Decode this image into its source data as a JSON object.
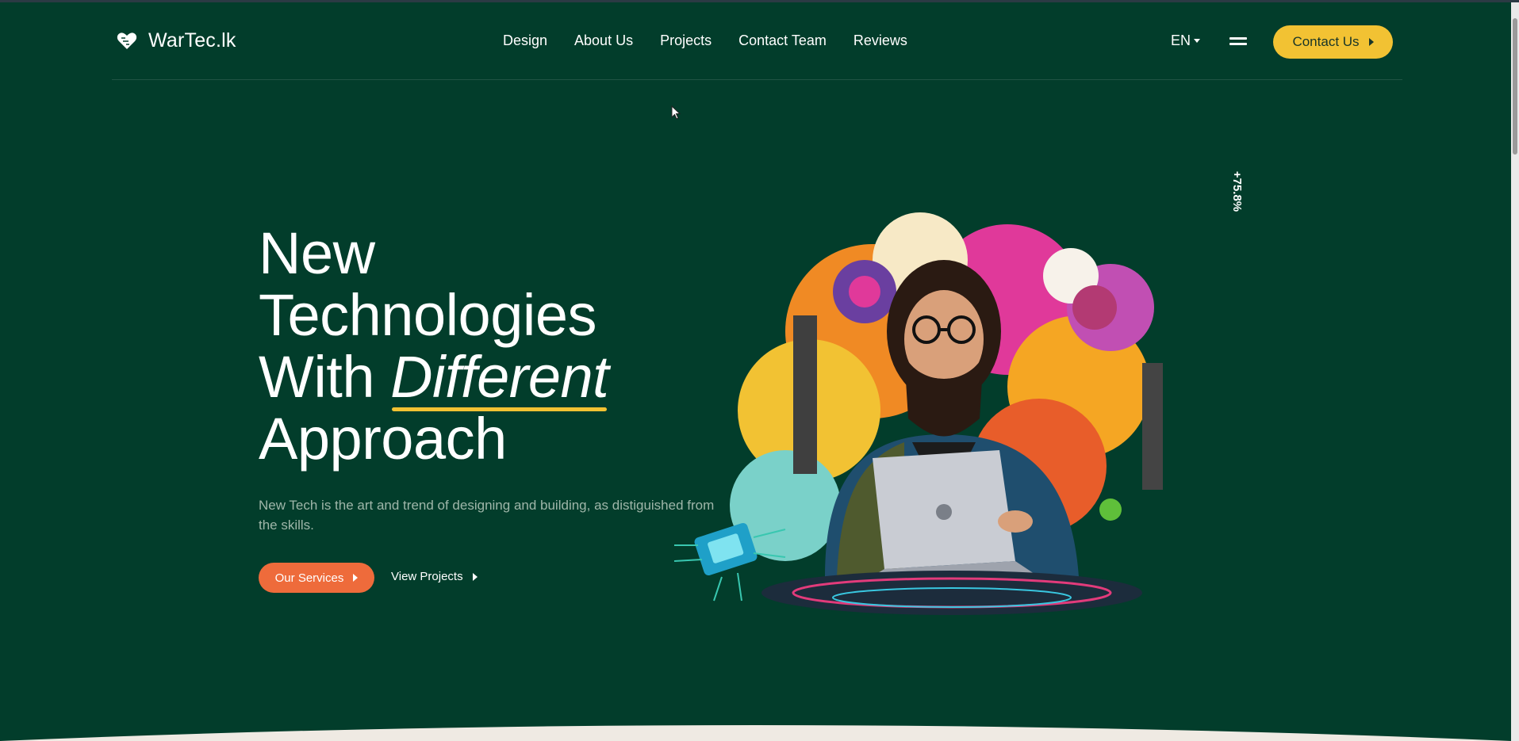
{
  "header": {
    "brand": "WarTec.lk",
    "nav": [
      "Design",
      "About Us",
      "Projects",
      "Contact Team",
      "Reviews"
    ],
    "language": "EN",
    "contact_button": "Contact Us"
  },
  "hero": {
    "title_line1": "New",
    "title_line2": "Technologies",
    "title_line3_prefix": "With",
    "title_line3_emphasis": "Different",
    "title_line4": "Approach",
    "description": "New Tech is the art and trend of designing and building, as distiguished from the skills.",
    "primary_button": "Our Services",
    "secondary_button": "View Projects",
    "stat": "+75.8%"
  },
  "colors": {
    "background": "#023d2b",
    "accent_yellow": "#f2c233",
    "accent_orange": "#ee6b3b"
  },
  "icons": [
    "heart-logo-icon",
    "caret-down-icon",
    "menu-icon",
    "arrow-right-icon",
    "mouse-cursor-icon"
  ]
}
